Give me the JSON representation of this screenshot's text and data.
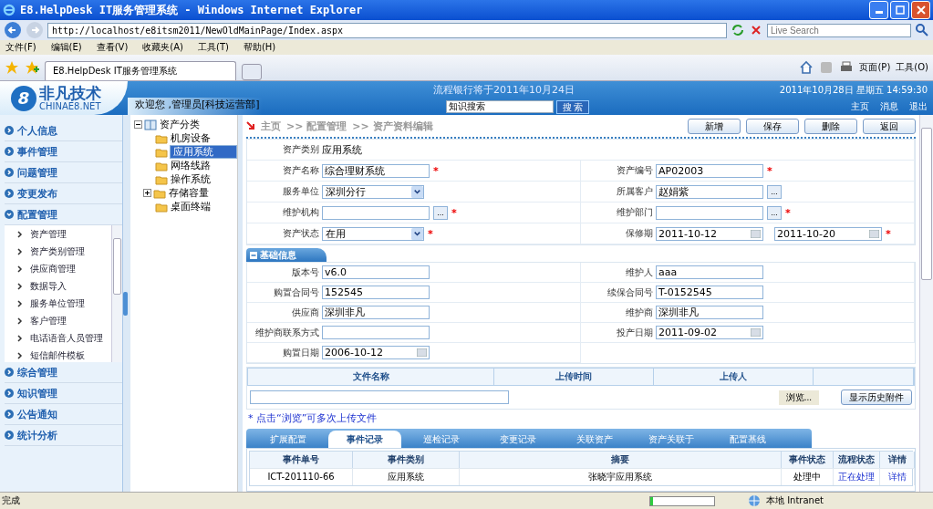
{
  "browser": {
    "title": "E8.HelpDesk IT服务管理系统 - Windows Internet Explorer",
    "address": "http://localhost/e8itsm2011/NewOldMainPage/Index.aspx",
    "search_placeholder": "Live Search",
    "menu": [
      "文件(F)",
      "编辑(E)",
      "查看(V)",
      "收藏夹(A)",
      "工具(T)",
      "帮助(H)"
    ],
    "tab_title": "E8.HelpDesk IT服务管理系统",
    "tools": [
      "页面(P)",
      "工具(O)"
    ]
  },
  "header": {
    "logo_mark": "8",
    "logo_text": "非凡技术",
    "logo_sub": "CHINAE8.NET",
    "welcome": "欢迎您 ,管理员[科技运营部]",
    "notice": "流程银行将于2011年10月24日",
    "search_value": "知识搜索",
    "search_button": "搜 索",
    "datetime": "2011年10月28日 星期五 14:59:30",
    "links": [
      "主页",
      "消息",
      "退出"
    ]
  },
  "nav": [
    {
      "label": "个人信息",
      "expanded": false
    },
    {
      "label": "事件管理",
      "expanded": false
    },
    {
      "label": "问题管理",
      "expanded": false
    },
    {
      "label": "变更发布",
      "expanded": false
    },
    {
      "label": "配置管理",
      "expanded": true,
      "children": [
        "资产管理",
        "资产类别管理",
        "供应商管理",
        "数据导入",
        "服务单位管理",
        "客户管理",
        "电话语音人员管理",
        "短信邮件模板"
      ]
    },
    {
      "label": "综合管理",
      "expanded": false
    },
    {
      "label": "知识管理",
      "expanded": false
    },
    {
      "label": "公告通知",
      "expanded": false
    },
    {
      "label": "统计分析",
      "expanded": false
    }
  ],
  "tree": {
    "label": "资产分类",
    "expanded": true,
    "children": [
      {
        "label": "机房设备",
        "selected": false,
        "expandable": false
      },
      {
        "label": "应用系统",
        "selected": true,
        "expandable": false
      },
      {
        "label": "网络线路",
        "selected": false,
        "expandable": false
      },
      {
        "label": "操作系统",
        "selected": false,
        "expandable": false
      },
      {
        "label": "存储容量",
        "selected": false,
        "expandable": true
      },
      {
        "label": "桌面终端",
        "selected": false,
        "expandable": false
      }
    ]
  },
  "breadcrumb": [
    "主页",
    ">> 配置管理",
    ">> 资产资料编辑"
  ],
  "actions": [
    "新增",
    "保存",
    "删除",
    "返回"
  ],
  "required_mark": "*",
  "asset_type": {
    "label": "资产类别",
    "value": "应用系统"
  },
  "fields": [
    {
      "label": "资产名称",
      "kind": "text",
      "value": "综合理财系统",
      "required": true
    },
    {
      "label": "资产编号",
      "kind": "text",
      "value": "AP02003",
      "required": true
    },
    {
      "label": "服务单位",
      "kind": "select",
      "value": "深圳分行",
      "required": false
    },
    {
      "label": "所属客户",
      "kind": "lookup",
      "value": "赵娟紫",
      "button": "...",
      "required": false
    },
    {
      "label": "维护机构",
      "kind": "lookup",
      "button": "...",
      "required": true
    },
    {
      "label": "维护部门",
      "kind": "lookup",
      "button": "...",
      "required": true
    },
    {
      "label": "资产状态",
      "kind": "select",
      "value": "在用",
      "required": true
    },
    {
      "label": "保修期",
      "kind": "daterange",
      "value": "2011-10-12",
      "value_end": "2011-10-20",
      "required": true
    }
  ],
  "basic": {
    "title": "基础信息",
    "expanded": true,
    "fields": [
      {
        "label": "版本号",
        "kind": "text",
        "value": "v6.0"
      },
      {
        "label": "维护人",
        "kind": "text",
        "value": "aaa"
      },
      {
        "label": "购置合同号",
        "kind": "text",
        "value": "152545"
      },
      {
        "label": "续保合同号",
        "kind": "text",
        "value": "T-0152545"
      },
      {
        "label": "供应商",
        "kind": "text",
        "value": "深圳非凡"
      },
      {
        "label": "维护商",
        "kind": "text",
        "value": "深圳非凡"
      },
      {
        "label": "维护商联系方式",
        "kind": "text"
      },
      {
        "label": "投产日期",
        "kind": "date",
        "value": "2011-09-02"
      },
      {
        "label": "购置日期",
        "kind": "date",
        "value": "2006-10-12"
      }
    ]
  },
  "attachments": {
    "columns": [
      "文件名称",
      "上传时间",
      "上传人"
    ],
    "browse_button": "浏览...",
    "history_button": "显示历史附件",
    "hint": "* 点击“浏览”可多次上传文件"
  },
  "tabs": [
    {
      "label": "扩展配置",
      "selected": false
    },
    {
      "label": "事件记录",
      "selected": true
    },
    {
      "label": "巡检记录",
      "selected": false
    },
    {
      "label": "变更记录",
      "selected": false
    },
    {
      "label": "关联资产",
      "selected": false
    },
    {
      "label": "资产关联于",
      "selected": false
    },
    {
      "label": "配置基线",
      "selected": false
    }
  ],
  "table": {
    "columns": [
      {
        "label": "事件单号",
        "kind": "text"
      },
      {
        "label": "事件类别",
        "kind": "text"
      },
      {
        "label": "摘要",
        "kind": "text"
      },
      {
        "label": "事件状态",
        "kind": "text"
      },
      {
        "label": "流程状态",
        "kind": "link"
      },
      {
        "label": "详情",
        "kind": "link"
      }
    ],
    "rows": [
      [
        "ICT-201110-66",
        "应用系统",
        "张晓宇应用系统",
        "处理中",
        "正在处理",
        "详情"
      ]
    ]
  },
  "status_bar": {
    "text": "完成",
    "level": 0.05,
    "zone": "本地 Intranet"
  }
}
